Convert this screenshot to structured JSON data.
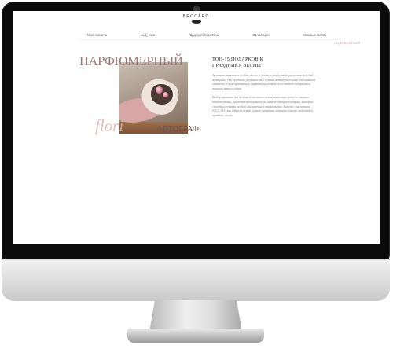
{
  "site": {
    "brand_name": "BROCARD"
  },
  "nav": {
    "items": [
      "Моя новость",
      "Lady Ince",
      "Гардероб перлстны",
      "Коллекция",
      "Мнимые места"
    ],
    "cta_label": "ПОДПИСАТЬСЯ"
  },
  "hero": {
    "title": "ПАРФЮМЕРНЫЙ",
    "script_text": "flori",
    "subtitle": "АВТОГРАФ"
  },
  "article": {
    "title_line1": "ТОП-15 ПОДАРКОВ К",
    "title_line2": "ПРАЗДНИКУ ВЕСНЫ",
    "paragraph1": "Ароматы занимают особое место в жизни и выступают ритуалом каждый женщины. Они придают уверенность, служат подтверждением собственной личности. Такой ароматный парфюмерный аксессуар станет прекрасным началом нового сезона.",
    "paragraph2_before": "Выбор аромата для будущего весеннего сезона выполнен сразу по личным впечатлениям. Представляем новинки по интересующим позициям, которые способны создать особый настроение в парфюмерии. Вместе с магазином",
    "paragraph2_link": "BROCARD",
    "paragraph2_after": "мы собрали самые лучшие ароматы, которые хорошо подходят в праздник весны."
  }
}
